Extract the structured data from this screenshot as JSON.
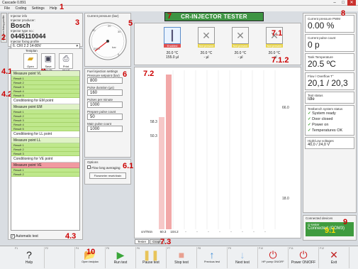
{
  "window": {
    "title": "Cascade 0.891"
  },
  "menu": [
    "File",
    "Coding",
    "Settings",
    "Help"
  ],
  "annotations": [
    "1",
    "2",
    "3",
    "4",
    "4.1",
    "4.2",
    "4.3",
    "5",
    "6",
    "6.1",
    "7",
    "7.1",
    "7.1.2",
    "7.2",
    "7.3",
    "8",
    "9",
    "9.1",
    "10"
  ],
  "sidetab": {
    "label": "Injector fixing profile"
  },
  "injector": {
    "info_label": "Injector info",
    "producer_label": "Injector producer:",
    "producer": "Bosch",
    "type_label": "Injector type no.:",
    "type_no": "0445110044",
    "profile_label": "Injector fixing profile",
    "profile": "6. CRI 2.2 14-80V"
  },
  "testplan": {
    "title": "Testplan",
    "buttons": [
      "Open",
      "Save results",
      "Print report"
    ],
    "items": [
      {
        "kind": "mp",
        "label": "Measure point VL"
      },
      {
        "kind": "res",
        "label": "Result 1"
      },
      {
        "kind": "res",
        "label": "Result 2"
      },
      {
        "kind": "res",
        "label": "Result 3"
      },
      {
        "kind": "res",
        "label": "Result 4"
      },
      {
        "kind": "res",
        "label": "Result 5"
      },
      {
        "kind": "cond",
        "label": "Conditioning for EM point"
      },
      {
        "kind": "mp",
        "label": "Measure point EM"
      },
      {
        "kind": "res",
        "label": "Result 1"
      },
      {
        "kind": "res",
        "label": "Result 2"
      },
      {
        "kind": "res",
        "label": "Result 3"
      },
      {
        "kind": "res",
        "label": "Result 4"
      },
      {
        "kind": "res",
        "label": "Result 5"
      },
      {
        "kind": "cond",
        "label": "Conditioning for LL point"
      },
      {
        "kind": "mp",
        "label": "Measure point LL"
      },
      {
        "kind": "res",
        "label": "Result 1"
      },
      {
        "kind": "res",
        "label": "Result 2"
      },
      {
        "kind": "res",
        "label": "Result 3"
      },
      {
        "kind": "cond",
        "label": "Conditioning for VE point"
      },
      {
        "kind": "mp-red",
        "label": "Measure point VE"
      },
      {
        "kind": "res",
        "label": "Result 1"
      },
      {
        "kind": "res",
        "label": "Result 2"
      }
    ],
    "auto_test_label": "Automatic test"
  },
  "gauge": {
    "title": "Current pressure (bar)",
    "unit": "bar",
    "ticks": [
      "0",
      "10",
      "20",
      "30",
      "2000",
      "2100",
      "2200"
    ],
    "value": "0"
  },
  "fuel_settings": {
    "title": "Fuel injection settings",
    "pressure_label": "Pressure setpoint (bar)",
    "pressure": "800",
    "pulse_dur_label": "Pulse duration (µs)",
    "pulse_dur": "160",
    "pulses_label": "Pulses per minute",
    "pulses": "1000",
    "prepare_label": "Prepare pulse count",
    "prepare": "50",
    "main_label": "Main pulse count",
    "main": "1000",
    "options_title": "Options",
    "flow_avg_label": "Flow long averaging",
    "flowmeter_btn": "Flowmeter reset/drain"
  },
  "header": {
    "title": "CR-INJECTOR TESTER"
  },
  "injectors": [
    {
      "state": "Enabled",
      "temp": "20.0 °C",
      "sub": "155.0 µl",
      "active": true
    },
    {
      "state": "Not present",
      "temp": "20.0 °C",
      "sub": "- µl",
      "active": false
    },
    {
      "state": "Not present",
      "temp": "20.0 °C",
      "sub": "- µl",
      "active": false
    },
    {
      "state": "Not present",
      "temp": "20.0 °C",
      "sub": "- µl",
      "active": false
    }
  ],
  "graph": {
    "left_labels": [
      "58.3",
      "50.3"
    ],
    "right_labels": [
      "66.0",
      "18.0"
    ],
    "bottom_row": [
      "cm³/min",
      "60.3",
      "104.2",
      "-",
      "-",
      "-",
      "-",
      "-",
      "-",
      "-",
      "-"
    ],
    "tabs": [
      "Tester",
      "Graph"
    ]
  },
  "right": {
    "pwm_label": "Current pressure PWM",
    "pwm": "0.00 %",
    "pulse_label": "Current pulse count",
    "pulse": "0 p",
    "tank_label": "Tank Temperature",
    "tank": "20.5 ºC",
    "flow_label": "Flow / Overflow T°",
    "flow": "20,1 / 20,3",
    "status_label": "Test status",
    "status": "Idle",
    "sys_label": "Testbench system status",
    "sys_items": [
      "System ready",
      "Door closed",
      "Power on",
      "Temperatures OK"
    ],
    "volt_label": "High/Low voltages",
    "volt": "40,0 / 24,0 V",
    "devices_label": "Connected devices",
    "dev_name": "cr-tester",
    "dev_conn": "Connected (COM3)"
  },
  "footer": [
    {
      "key": "F1",
      "label": "Help",
      "icon": "?",
      "color": "#222"
    },
    {
      "key": "F2",
      "label": "",
      "icon": "",
      "color": "#222"
    },
    {
      "key": "F4",
      "label": "Open testplan",
      "icon": "📂",
      "color": "#d9a521"
    },
    {
      "key": "F5",
      "label": "Run test",
      "icon": "▶",
      "color": "#3aa63a"
    },
    {
      "key": "F6",
      "label": "Pause test",
      "icon": "❚❚",
      "color": "#e8c45a"
    },
    {
      "key": "F7",
      "label": "Stop test",
      "icon": "■",
      "color": "#e8a090"
    },
    {
      "key": "F8",
      "label": "Previous test",
      "icon": "↑",
      "color": "#3a8ad8"
    },
    {
      "key": "F9",
      "label": "Next test",
      "icon": "↓",
      "color": "#9cc2ea"
    },
    {
      "key": "F10",
      "label": "HP pump ON/OFF",
      "icon": "⏻",
      "color": "#d02020"
    },
    {
      "key": "F11",
      "label": "Power ON/OFF",
      "icon": "⏻",
      "color": "#d02020"
    },
    {
      "key": "F12",
      "label": "Exit",
      "icon": "✕",
      "color": "#c02020"
    }
  ]
}
